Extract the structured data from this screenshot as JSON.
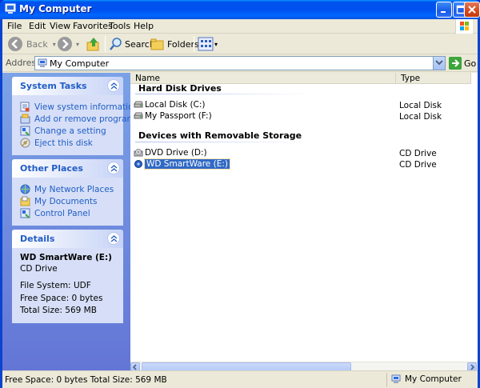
{
  "window": {
    "title": "My Computer"
  },
  "menu": [
    "File",
    "Edit",
    "View",
    "Favorites",
    "Tools",
    "Help"
  ],
  "toolbar": {
    "back": "Back",
    "search": "Search",
    "folders": "Folders"
  },
  "address": {
    "label": "Address",
    "value": "My Computer",
    "go": "Go"
  },
  "tasks": {
    "system_title": "System Tasks",
    "system_items": [
      "View system information",
      "Add or remove programs",
      "Change a setting",
      "Eject this disk"
    ],
    "places_title": "Other Places",
    "places_items": [
      "My Network Places",
      "My Documents",
      "Control Panel"
    ],
    "details_title": "Details",
    "details": {
      "name": "WD SmartWare (E:)",
      "kind": "CD Drive",
      "fs": "File System: UDF",
      "free": "Free Space: 0 bytes",
      "total": "Total Size: 569 MB"
    }
  },
  "columns": {
    "name": "Name",
    "type": "Type"
  },
  "groups": {
    "hdd": "Hard Disk Drives",
    "removable": "Devices with Removable Storage"
  },
  "items": [
    {
      "name": "Local Disk (C:)",
      "type": "Local Disk"
    },
    {
      "name": "My Passport (F:)",
      "type": "Local Disk"
    },
    {
      "name": "DVD Drive (D:)",
      "type": "CD Drive"
    },
    {
      "name": "WD SmartWare (E:)",
      "type": "CD Drive"
    }
  ],
  "status": {
    "left": "Free Space: 0 bytes Total Size: 569 MB",
    "right": "My Computer"
  }
}
